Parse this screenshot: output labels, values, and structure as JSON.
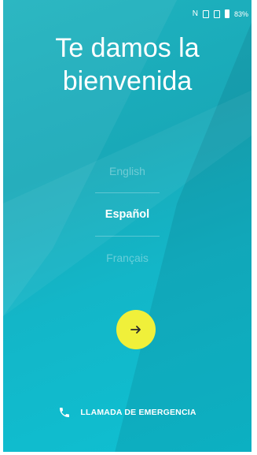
{
  "status_bar": {
    "battery": "83%",
    "icons": [
      "nfc-icon",
      "sim-icon",
      "sim-icon",
      "battery-icon"
    ]
  },
  "welcome": {
    "title_line1": "Te damos la",
    "title_line2": "bienvenida"
  },
  "languages": {
    "items": [
      {
        "label": "English",
        "selected": false
      },
      {
        "label": "Español",
        "selected": true
      },
      {
        "label": "Français",
        "selected": false
      }
    ]
  },
  "next_button": {
    "icon": "arrow-right-icon"
  },
  "emergency": {
    "label": "LLAMADA DE EMERGENCIA",
    "icon": "phone-icon"
  },
  "colors": {
    "background": "#18adbc",
    "accent_button": "#f0f03a"
  }
}
